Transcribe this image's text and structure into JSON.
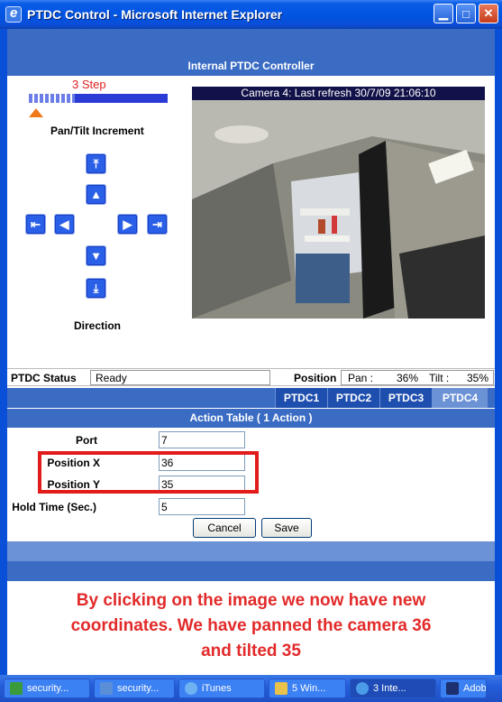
{
  "window": {
    "title": "PTDC Control - Microsoft Internet Explorer",
    "minimize_glyph": "▁",
    "maximize_glyph": "□",
    "close_glyph": "✕"
  },
  "panel": {
    "header": "Internal PTDC Controller",
    "step_label": "3 Step",
    "step_level": 0.67,
    "pan_tilt_label": "Pan/Tilt Increment",
    "direction_label": "Direction",
    "arrows": {
      "top": "⤒",
      "up": "▲",
      "left_end": "⇤",
      "left": "◀",
      "right": "▶",
      "right_end": "⇥",
      "down": "▼",
      "bottom": "⤓"
    }
  },
  "camera": {
    "caption": "Camera 4: Last refresh 30/7/09 21:06:10"
  },
  "status": {
    "label": "PTDC Status",
    "value": "Ready",
    "position_label": "Position",
    "pan_label": "Pan :",
    "pan_value": "36%",
    "tilt_label": "Tilt :",
    "tilt_value": "35%"
  },
  "tabs": [
    {
      "label": "PTDC1",
      "active": false
    },
    {
      "label": "PTDC2",
      "active": false
    },
    {
      "label": "PTDC3",
      "active": false
    },
    {
      "label": "PTDC4",
      "active": true
    }
  ],
  "action_table": {
    "header": "Action Table ( 1 Action )",
    "fields": [
      {
        "label": "Port",
        "value": "7"
      },
      {
        "label": "Position X",
        "value": "36"
      },
      {
        "label": "Position Y",
        "value": "35"
      },
      {
        "label": "Hold Time (Sec.)",
        "value": "5"
      }
    ],
    "cancel_label": "Cancel",
    "save_label": "Save"
  },
  "annotation": {
    "line1": "By clicking on the image we now have new",
    "line2": "coordinates. We have panned the camera 36",
    "line3": "and tilted 35"
  },
  "taskbar": [
    {
      "label": "security...",
      "active": false,
      "color": "#3a9b3a"
    },
    {
      "label": "security...",
      "active": false,
      "color": "#5a8fd8"
    },
    {
      "label": "iTunes",
      "active": false,
      "color": "#6fb2f2"
    },
    {
      "label": "5 Win...",
      "active": false,
      "color": "#e8c24a"
    },
    {
      "label": "3 Inte...",
      "active": true,
      "color": "#4a9be8"
    },
    {
      "label": "Adobe",
      "active": false,
      "color": "#1c2f6e"
    }
  ],
  "colors": {
    "accent_blue": "#3a6cc4",
    "highlight_red": "#e21b1b",
    "caption_red": "#e22a2a"
  }
}
